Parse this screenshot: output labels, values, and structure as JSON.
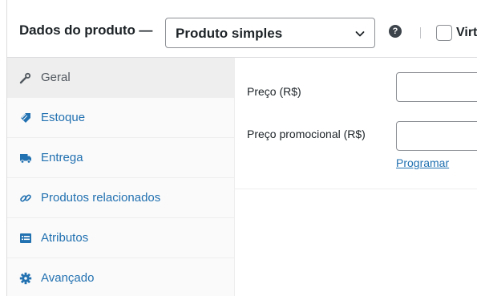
{
  "header": {
    "title": "Dados do produto —",
    "product_type": "Produto simples",
    "help_icon": "help-icon",
    "virtual_label": "Virt"
  },
  "tabs": [
    {
      "label": "Geral",
      "icon": "wrench-icon",
      "active": true
    },
    {
      "label": "Estoque",
      "icon": "tag-icon",
      "active": false
    },
    {
      "label": "Entrega",
      "icon": "truck-icon",
      "active": false
    },
    {
      "label": "Produtos relacionados",
      "icon": "link-icon",
      "active": false
    },
    {
      "label": "Atributos",
      "icon": "list-icon",
      "active": false
    },
    {
      "label": "Avançado",
      "icon": "gear-icon",
      "active": false
    }
  ],
  "fields": {
    "regular_price_label": "Preço (R$)",
    "regular_price_value": "",
    "sale_price_label": "Preço promocional (R$)",
    "sale_price_value": "",
    "schedule_link": "Programar"
  },
  "colors": {
    "link": "#2271b1",
    "text": "#1d2327",
    "active_tab_bg": "#eeeeee",
    "tabs_bg": "#fafafa"
  }
}
